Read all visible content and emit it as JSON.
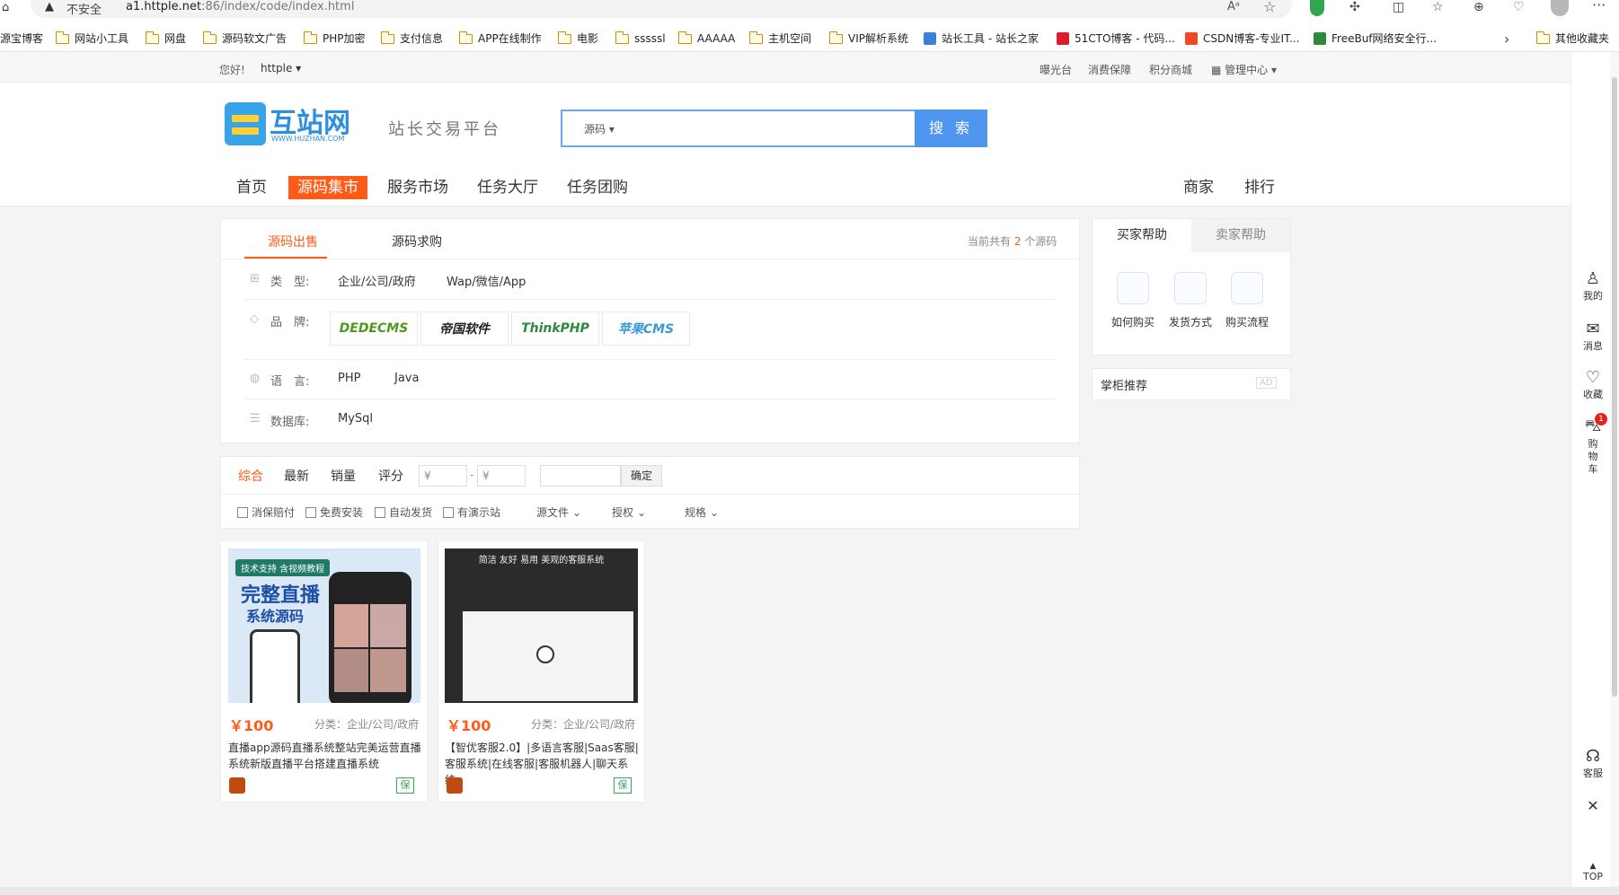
{
  "browser": {
    "security": "不安全",
    "url_host": "a1.httple.net",
    "url_rest": ":86/index/code/index.html",
    "bookmarks": [
      "源宝博客",
      "网站小工具",
      "网盘",
      "源码软文广告",
      "PHP加密",
      "支付信息",
      "APP在线制作",
      "电影",
      "sssssl",
      "AAAAA",
      "主机空间",
      "VIP解析系统",
      "站长工具 - 站长之家",
      "51CTO博客 - 代码...",
      "CSDN博客-专业IT...",
      "FreeBuf网络安全行...",
      "其他收藏夹"
    ]
  },
  "topbar": {
    "greeting": "您好!",
    "user": "httple",
    "links": [
      "曝光台",
      "消费保障",
      "积分商城",
      "管理中心"
    ]
  },
  "header": {
    "logo_main": "互站网",
    "logo_sub": "WWW.HUZHAN.COM",
    "slogan": "站长交易平台",
    "search_type": "源码",
    "search_placeholder": "",
    "search_button": "搜 索"
  },
  "nav": {
    "left": [
      "首页",
      "源码集市",
      "服务市场",
      "任务大厅",
      "任务团购"
    ],
    "right": [
      "商家",
      "排行"
    ]
  },
  "filter": {
    "tabs": [
      "源码出售",
      "源码求购"
    ],
    "count_prefix": "当前共有 ",
    "count": "2",
    "count_suffix": " 个源码",
    "type_label": "类　型:",
    "types": [
      "企业/公司/政府",
      "Wap/微信/App"
    ],
    "brand_label": "品　牌:",
    "brands": [
      "DEDECMS",
      "帝国软件",
      "ThinkPHP",
      "苹果CMS"
    ],
    "lang_label": "语　言:",
    "langs": [
      "PHP",
      "Java"
    ],
    "db_label": "数据库:",
    "dbs": [
      "MySql"
    ]
  },
  "sort": {
    "items": [
      "综合",
      "最新",
      "销量",
      "评分"
    ],
    "price_min": "¥",
    "price_max": "¥",
    "confirm": "确定",
    "checks": [
      "消保赔付",
      "免费安装",
      "自动发货",
      "有演示站"
    ],
    "dropdowns": [
      "源文件",
      "授权",
      "规格"
    ]
  },
  "products": [
    {
      "banner": "技术支持 含视频教程",
      "img_title": "完整直播",
      "img_sub": "系统源码",
      "price": "￥100",
      "category": "分类：企业/公司/政府",
      "title": "直播app源码直播系统整站完美运营直播系统新版直播平台搭建直播系统",
      "badge": "保"
    },
    {
      "img_title": "简洁 友好 易用 美观的客服系统",
      "price": "￥100",
      "category": "分类：企业/公司/政府",
      "title": "【智优客服2.0】|多语言客服|Saas客服|客服系统|在线客服|客服机器人|聊天系统",
      "badge": "保"
    }
  ],
  "help": {
    "tabs": [
      "买家帮助",
      "卖家帮助"
    ],
    "items": [
      "如何购买",
      "发货方式",
      "购买流程"
    ],
    "recommend": "掌柜推荐",
    "ad": "AD"
  },
  "sidebar": {
    "items": [
      "我的",
      "消息",
      "收藏",
      "购物车"
    ],
    "cart_count": "1",
    "service": "客服",
    "top": "TOP"
  },
  "colors": {
    "accent": "#ff5b17",
    "blue": "#4f96ee"
  }
}
